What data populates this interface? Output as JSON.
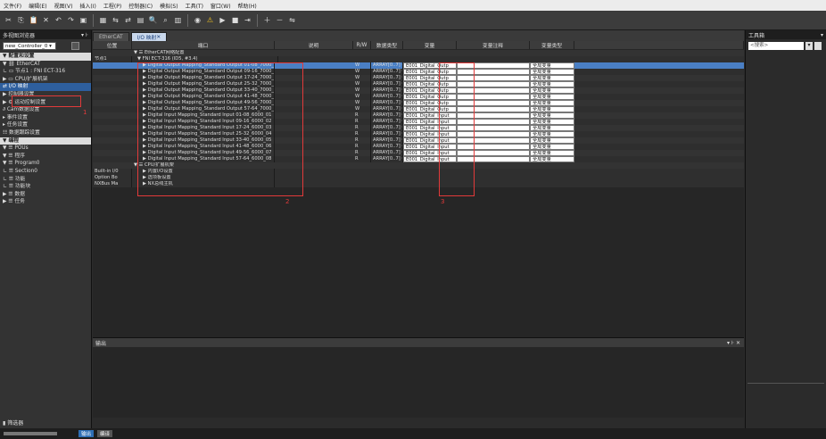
{
  "menubar": [
    "文件(F)",
    "编辑(E)",
    "视图(V)",
    "插入(I)",
    "工程(P)",
    "控制器(C)",
    "模拟(S)",
    "工具(T)",
    "窗口(W)",
    "帮助(H)"
  ],
  "toolbar_icons": [
    "cut-icon",
    "copy-icon",
    "paste-icon",
    "delete-icon",
    "undo-icon",
    "redo-icon",
    "save-icon",
    "build-icon",
    "compare-icon",
    "transfer-icon",
    "grid-icon",
    "search-icon",
    "find-icon",
    "monitor-icon",
    "online-icon",
    "warning-icon",
    "run-icon",
    "stop-icon",
    "step-icon",
    "zoom-in-icon",
    "zoom-out-icon",
    "cross-reference-icon"
  ],
  "left": {
    "title": "多视图浏览器",
    "controller": "new_Controller_0",
    "sections": [
      {
        "label": "配置和设置",
        "items": [
          {
            "text": "▼ ⛓ EtherCAT"
          },
          {
            "text": "   ∟ ▭ 节点1 : FNI ECT-316"
          },
          {
            "text": " ▶ ▭ CPU/扩展机架"
          },
          {
            "text": "   ⇄ I/O 映射",
            "selected": true
          },
          {
            "text": " ▶ 控制器设置"
          },
          {
            "text": " ▶ ⚙ 运动控制设置"
          },
          {
            "text": "   ∂ Cam数据设置"
          },
          {
            "text": "   ▸ 事件设置"
          },
          {
            "text": "   ▸ 任务设置"
          },
          {
            "text": "   ☷ 数据跟踪设置"
          }
        ]
      },
      {
        "label": "编程",
        "items": [
          {
            "text": " ▼ ☰ POUs"
          },
          {
            "text": "   ▼ ☰ 程序"
          },
          {
            "text": "     ▼ ☰ Program0"
          },
          {
            "text": "        ∟ ☰ Section0"
          },
          {
            "text": "   ∟ ☰ 功能"
          },
          {
            "text": "   ∟ ☰ 功能块"
          },
          {
            "text": " ▶ ☰ 数据"
          },
          {
            "text": " ▶ ☰ 任务"
          }
        ]
      }
    ],
    "filter_label": "筛选器"
  },
  "tabs": [
    {
      "label": "EtherCAT",
      "active": false
    },
    {
      "label": "I/O 映射",
      "active": true
    }
  ],
  "grid": {
    "headers": [
      "位置",
      "端口",
      "说明",
      "R/W",
      "数据类型",
      "变量",
      "变量注释",
      "变量类型"
    ],
    "group1": "EtherCAT网络配置",
    "node": {
      "pos": "节点1",
      "port": "FNI ECT-316 (ID5, #3.4)"
    },
    "rows": [
      {
        "port": "Digital Output Mapping_Standard Output 01-08_7000_01",
        "rw": "W",
        "type": "ARRAY[0..7] O",
        "var": "E001_Digital_Outp",
        "vtype": "全局变量",
        "selected": true
      },
      {
        "port": "Digital Output Mapping_Standard Output 09-16_7000_02",
        "rw": "W",
        "type": "ARRAY[0..7] O",
        "var": "E001_Digital_Outp",
        "vtype": "全局变量"
      },
      {
        "port": "Digital Output Mapping_Standard Output 17-24_7000_03",
        "rw": "W",
        "type": "ARRAY[0..7] O",
        "var": "E001_Digital_Outp",
        "vtype": "全局变量"
      },
      {
        "port": "Digital Output Mapping_Standard Output 25-32_7000_04",
        "rw": "W",
        "type": "ARRAY[0..7] O",
        "var": "E001_Digital_Outp",
        "vtype": "全局变量"
      },
      {
        "port": "Digital Output Mapping_Standard Output 33-40_7000_05",
        "rw": "W",
        "type": "ARRAY[0..7] O",
        "var": "E001_Digital_Outp",
        "vtype": "全局变量"
      },
      {
        "port": "Digital Output Mapping_Standard Output 41-48_7000_06",
        "rw": "W",
        "type": "ARRAY[0..7] O",
        "var": "E001_Digital_Outp",
        "vtype": "全局变量"
      },
      {
        "port": "Digital Output Mapping_Standard Output 49-56_7000_07",
        "rw": "W",
        "type": "ARRAY[0..7] O",
        "var": "E001_Digital_Outp",
        "vtype": "全局变量"
      },
      {
        "port": "Digital Output Mapping_Standard Output 57-64_7000_08",
        "rw": "W",
        "type": "ARRAY[0..7] O",
        "var": "E001_Digital_Outp",
        "vtype": "全局变量"
      },
      {
        "port": "Digital Input Mapping_Standard Input 01-08_6000_01",
        "rw": "R",
        "type": "ARRAY[0..7] O",
        "var": "E001_Digital_Input",
        "vtype": "全局变量"
      },
      {
        "port": "Digital Input Mapping_Standard Input 09-16_6000_02",
        "rw": "R",
        "type": "ARRAY[0..7] O",
        "var": "E001_Digital_Input",
        "vtype": "全局变量"
      },
      {
        "port": "Digital Input Mapping_Standard Input 17-24_6000_03",
        "rw": "R",
        "type": "ARRAY[0..7] O",
        "var": "E001_Digital_Input",
        "vtype": "全局变量"
      },
      {
        "port": "Digital Input Mapping_Standard Input 25-32_6000_04",
        "rw": "R",
        "type": "ARRAY[0..7] O",
        "var": "E001_Digital_Input",
        "vtype": "全局变量"
      },
      {
        "port": "Digital Input Mapping_Standard Input 33-40_6000_05",
        "rw": "R",
        "type": "ARRAY[0..7] O",
        "var": "E001_Digital_Input",
        "vtype": "全局变量"
      },
      {
        "port": "Digital Input Mapping_Standard Input 41-48_6000_06",
        "rw": "R",
        "type": "ARRAY[0..7] O",
        "var": "E001_Digital_Input",
        "vtype": "全局变量"
      },
      {
        "port": "Digital Input Mapping_Standard Input 49-56_6000_07",
        "rw": "R",
        "type": "ARRAY[0..7] O",
        "var": "E001_Digital_Input",
        "vtype": "全局变量"
      },
      {
        "port": "Digital Input Mapping_Standard Input 57-64_6000_08",
        "rw": "R",
        "type": "ARRAY[0..7] O",
        "var": "E001_Digital_Input",
        "vtype": "全局变量"
      }
    ],
    "group2": "CPU/扩展机架",
    "extra_rows": [
      {
        "pos": "Built-in I/0",
        "port": "内置I/O设置"
      },
      {
        "pos": "Option Bo",
        "port": "选项板设置"
      },
      {
        "pos": "NXBus Ma",
        "port": "NX总线主机"
      }
    ],
    "annotation_1": "1",
    "annotation_2": "2",
    "annotation_3": "3"
  },
  "output": {
    "title": "输出",
    "controls": "▾ ⊦ ✕"
  },
  "right": {
    "title": "工具箱",
    "search_placeholder": "<搜索>"
  },
  "statusbar": {
    "btn1": "输出",
    "btn2": "编译"
  }
}
